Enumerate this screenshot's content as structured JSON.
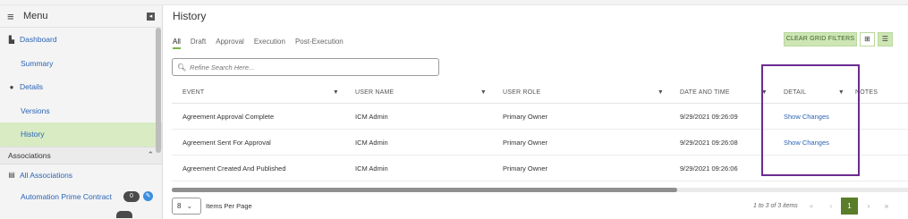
{
  "sidebar": {
    "menu_title": "Menu",
    "items": [
      {
        "label": "Dashboard",
        "icon": "chart-icon"
      },
      {
        "label": "Summary"
      },
      {
        "label": "Details",
        "icon": "info-icon"
      },
      {
        "label": "Versions"
      },
      {
        "label": "History",
        "active": true
      }
    ],
    "associations_label": "Associations",
    "all_associations": "All Associations",
    "contract": {
      "label": "Automation Prime Contract",
      "count": "0"
    }
  },
  "page": {
    "title": "History",
    "tabs": [
      "All",
      "Draft",
      "Approval",
      "Execution",
      "Post-Execution"
    ],
    "clear_filters": "CLEAR GRID FILTERS",
    "search_placeholder": "Refine Search Here..."
  },
  "grid": {
    "columns": [
      "EVENT",
      "USER NAME",
      "USER ROLE",
      "DATE AND TIME",
      "DETAIL",
      "NOTES"
    ],
    "rows": [
      {
        "event": "Agreement Approval Complete",
        "user": "ICM Admin",
        "role": "Primary Owner",
        "date": "9/29/2021 09:26:09",
        "detail": "Show Changes"
      },
      {
        "event": "Agreement Sent For Approval",
        "user": "ICM Admin",
        "role": "Primary Owner",
        "date": "9/29/2021 09:26:08",
        "detail": "Show Changes"
      },
      {
        "event": "Agreement Created And Published",
        "user": "ICM Admin",
        "role": "Primary Owner",
        "date": "9/29/2021 09:26:06",
        "detail": ""
      }
    ]
  },
  "footer": {
    "per_page": "8",
    "per_page_label": "Items Per Page",
    "count_text": "1 to 3 of 3 items",
    "current_page": "1"
  },
  "colors": {
    "accent": "#7ab648",
    "link": "#2a64b6",
    "highlight": "#6a2c91"
  }
}
